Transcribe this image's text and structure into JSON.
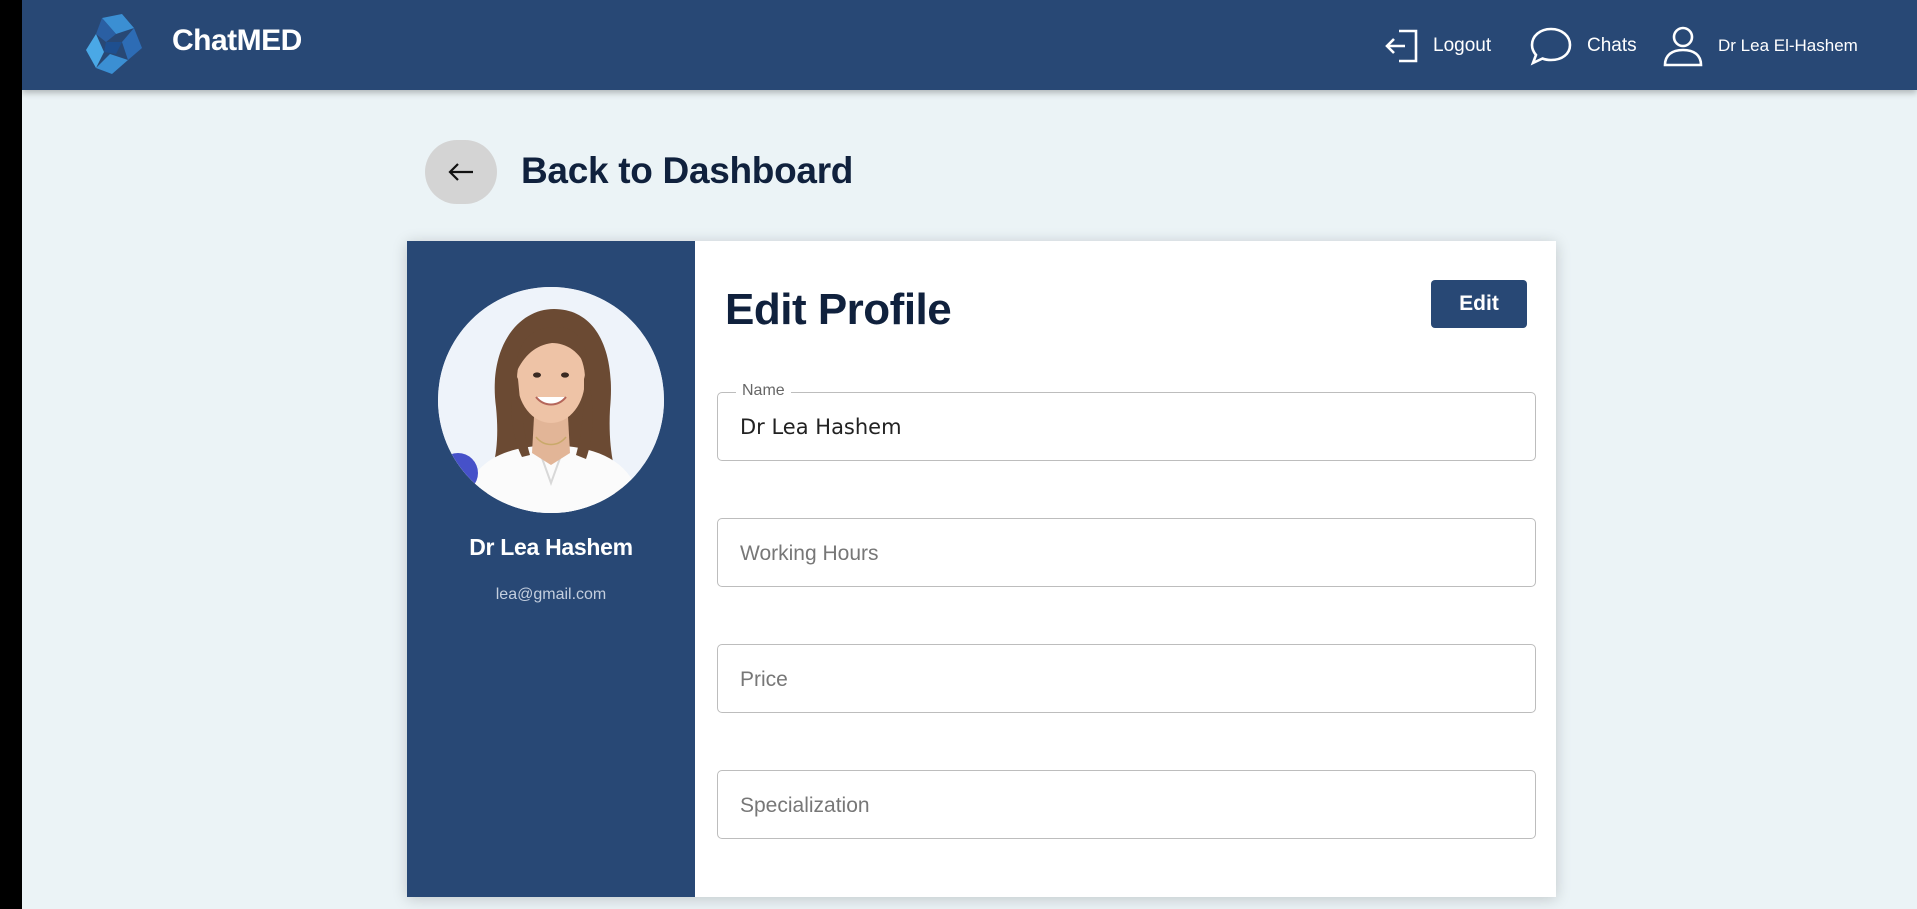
{
  "header": {
    "brand": "ChatMED",
    "nav": {
      "logout": "Logout",
      "chats": "Chats",
      "user": "Dr Lea El-Hashem"
    },
    "icons": [
      "chatmed-logo-icon",
      "logout-icon",
      "chat-bubble-icon",
      "user-icon"
    ]
  },
  "back": {
    "label": "Back to Dashboard",
    "icon": "arrow-left-icon"
  },
  "profile": {
    "name": "Dr Lea Hashem",
    "email": "lea@gmail.com"
  },
  "form": {
    "title": "Edit Profile",
    "edit_button": "Edit",
    "fields": {
      "name": {
        "label": "Name",
        "value": "Dr Lea Hashem"
      },
      "working_hours": {
        "placeholder": "Working Hours",
        "value": ""
      },
      "price": {
        "placeholder": "Price",
        "value": ""
      },
      "specialization": {
        "placeholder": "Specialization",
        "value": ""
      }
    }
  },
  "colors": {
    "primary": "#284875",
    "background": "#ebf3f6",
    "heading": "#10213d"
  }
}
